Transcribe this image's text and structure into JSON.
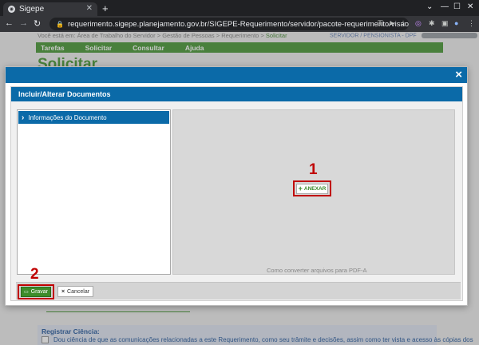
{
  "browser": {
    "tab_title": "Sigepe",
    "new_tab": "+",
    "url": "requerimento.sigepe.planejamento.gov.br/SIGEPE-Requerimento/servidor/pacote-requerimento/visao-servidor-solicitar.jsf?..."
  },
  "page": {
    "breadcrumb_prefix": "Você está em:",
    "breadcrumb": [
      "Área de Trabalho do Servidor",
      "Gestão de Pessoas",
      "Requerimento"
    ],
    "breadcrumb_current": "Solicitar",
    "breadcrumb_sep": ">",
    "user_role": "SERVIDOR / PENSIONISTA - DPF",
    "menu": [
      "Tarefas",
      "Solicitar",
      "Consultar",
      "Ajuda"
    ],
    "title": "Solicitar",
    "ciencia_title": "Registrar Ciência:",
    "ciencia_text": "Dou ciência de que as comunicações relacionadas a este Requerimento, como seu trâmite e decisões, assim como ter vista e acesso às cópias dos"
  },
  "dialog": {
    "close": "×",
    "panel_title": "Incluir/Alterar Documentos",
    "sidebar_item": "Informações do Documento",
    "anexar_label": "ANEXAR",
    "pdf_link": "Como converter arquivos para PDF-A",
    "gravar_label": "Gravar",
    "cancelar_label": "Cancelar",
    "marker_1": "1",
    "marker_2": "2"
  }
}
